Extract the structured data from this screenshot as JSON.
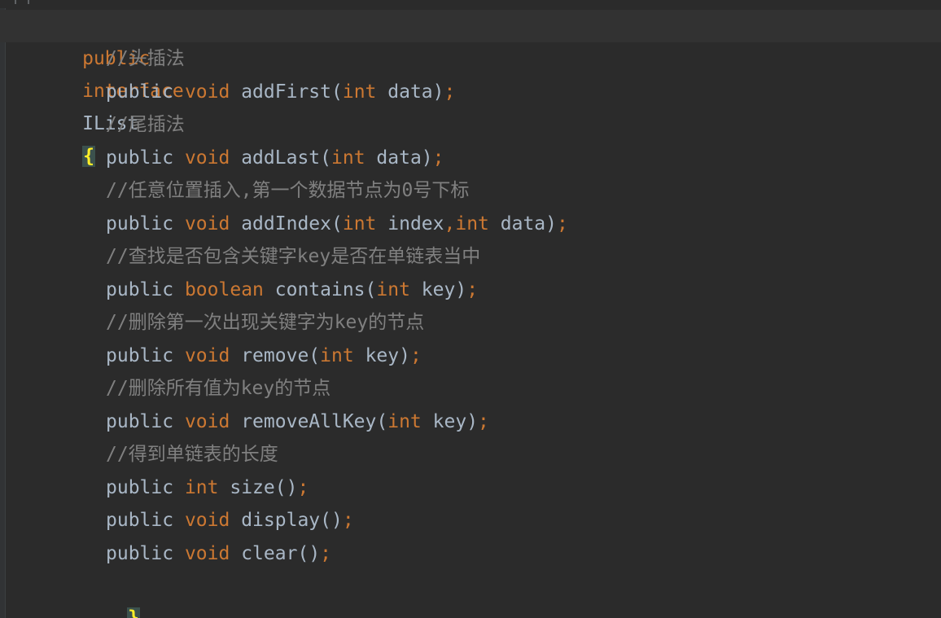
{
  "interface_decl": {
    "public": "public",
    "interface": "interface",
    "name": "IList",
    "open_brace": "{"
  },
  "lines": [
    {
      "kind": "comment",
      "text": "//头插法"
    },
    {
      "kind": "method",
      "public": "public",
      "ret": "void",
      "name": "addFirst",
      "open": "(",
      "params": [
        {
          "type": "int",
          "name": "data"
        }
      ],
      "close": ")",
      "semi": ";"
    },
    {
      "kind": "comment",
      "text": "//尾插法"
    },
    {
      "kind": "method",
      "public": "public",
      "ret": "void",
      "name": "addLast",
      "open": "(",
      "params": [
        {
          "type": "int",
          "name": "data"
        }
      ],
      "close": ")",
      "semi": ";"
    },
    {
      "kind": "comment",
      "text": "//任意位置插入,第一个数据节点为0号下标"
    },
    {
      "kind": "method",
      "public": "public",
      "ret": "void",
      "name": "addIndex",
      "open": "(",
      "params": [
        {
          "type": "int",
          "name": "index"
        },
        {
          "type": "int",
          "name": "data"
        }
      ],
      "close": ")",
      "semi": ";"
    },
    {
      "kind": "comment",
      "text": "//查找是否包含关键字key是否在单链表当中"
    },
    {
      "kind": "method",
      "public": "public",
      "ret": "boolean",
      "name": "contains",
      "open": "(",
      "params": [
        {
          "type": "int",
          "name": "key"
        }
      ],
      "close": ")",
      "semi": ";"
    },
    {
      "kind": "comment",
      "text": "//删除第一次出现关键字为key的节点"
    },
    {
      "kind": "method",
      "public": "public",
      "ret": "void",
      "name": "remove",
      "open": "(",
      "params": [
        {
          "type": "int",
          "name": "key"
        }
      ],
      "close": ")",
      "semi": ";"
    },
    {
      "kind": "comment",
      "text": "//删除所有值为key的节点"
    },
    {
      "kind": "method",
      "public": "public",
      "ret": "void",
      "name": "removeAllKey",
      "open": "(",
      "params": [
        {
          "type": "int",
          "name": "key"
        }
      ],
      "close": ")",
      "semi": ";"
    },
    {
      "kind": "comment",
      "text": "//得到单链表的长度"
    },
    {
      "kind": "method",
      "public": "public",
      "ret": "int",
      "name": "size",
      "open": "(",
      "params": [],
      "close": ")",
      "semi": ";"
    },
    {
      "kind": "method",
      "public": "public",
      "ret": "void",
      "name": "display",
      "open": "(",
      "params": [],
      "close": ")",
      "semi": ";"
    },
    {
      "kind": "method",
      "public": "public",
      "ret": "void",
      "name": "clear",
      "open": "(",
      "params": [],
      "close": ")",
      "semi": ";"
    }
  ],
  "close_brace": "}",
  "colors": {
    "background": "#2b2b2b",
    "keyword": "#cc7832",
    "plain": "#a9b7c6",
    "comment": "#808080",
    "brace_match": "#ffef28",
    "brace_match_bg": "#3b514d"
  }
}
